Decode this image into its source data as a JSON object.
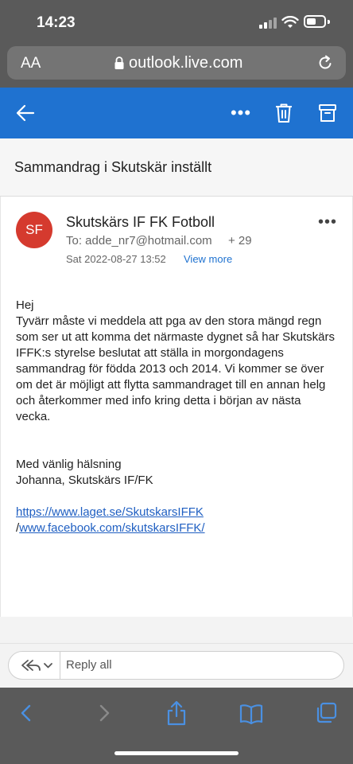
{
  "status_bar": {
    "time": "14:23"
  },
  "browser": {
    "text_size_label": "AA",
    "url": "outlook.live.com"
  },
  "toolbar": {
    "more_label": "•••"
  },
  "email": {
    "subject": "Sammandrag i Skutskär inställt",
    "avatar_initials": "SF",
    "sender": "Skutskärs IF FK Fotboll",
    "to": "To: adde_nr7@hotmail.com",
    "extra_recipients": "+ 29",
    "date": "Sat 2022-08-27 13:52",
    "view_more": "View more",
    "menu_label": "•••",
    "body": {
      "greeting": "Hej",
      "paragraph": "Tyvärr måste vi meddela att pga av den stora mängd regn som ser ut att komma det närmaste dygnet så har Skutskärs IFFK:s styrelse beslutat att ställa in morgondagens sammandrag för födda 2013 och 2014. Vi kommer se över om det är möjligt att flytta sammandraget till en annan helg och återkommer med info kring detta i början av nästa vecka.",
      "closing": "Med vänlig hälsning",
      "signature": "Johanna, Skutskärs IF/FK",
      "link1": "https://www.laget.se/SkutskarsIFFK",
      "link2_prefix": "/",
      "link2": "www.facebook.com/skutskarsIFFK/"
    }
  },
  "reply": {
    "label": "Reply all"
  },
  "colors": {
    "accent": "#1f72d0",
    "avatar": "#d53a2e",
    "chrome": "#5a5a5a",
    "link": "#1f5fc2"
  }
}
